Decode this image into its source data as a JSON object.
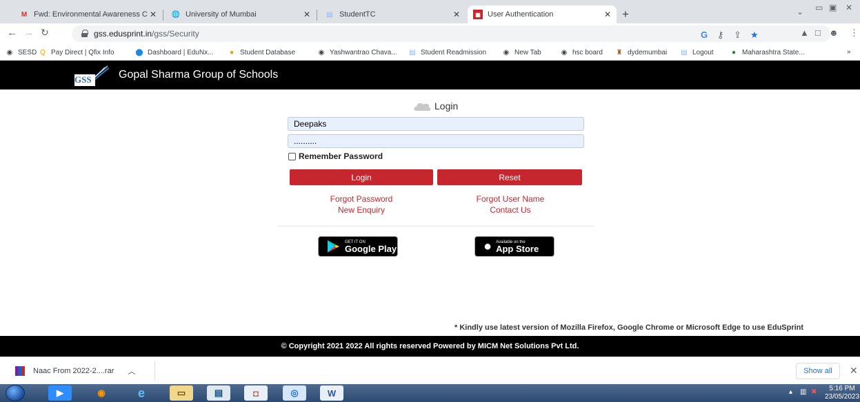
{
  "browser": {
    "tabs": [
      {
        "title": "Fwd: Environmental Awareness C",
        "icon": "gmail-icon"
      },
      {
        "title": "University of Mumbai",
        "icon": "globe-icon"
      },
      {
        "title": "StudentTC",
        "icon": "document-icon"
      },
      {
        "title": "User Authentication",
        "icon": "site-icon",
        "active": true
      }
    ],
    "address": {
      "host": "gss.edusprint.in",
      "path": "/gss/Security"
    },
    "bookmarks": [
      {
        "label": "SESD",
        "icon": "globe-icon"
      },
      {
        "label": "Pay Direct | Qfix Info",
        "icon": "qfix-icon"
      },
      {
        "label": "Dashboard | EduNx...",
        "icon": "edunx-icon"
      },
      {
        "label": "Student Database",
        "icon": "orange-dot-icon"
      },
      {
        "label": "Yashwantrao Chava...",
        "icon": "globe-icon"
      },
      {
        "label": "Student Readmission",
        "icon": "document-icon"
      },
      {
        "label": "New Tab",
        "icon": "globe-icon"
      },
      {
        "label": "hsc board",
        "icon": "globe-icon"
      },
      {
        "label": "dydemumbai",
        "icon": "emblem-icon"
      },
      {
        "label": "Logout",
        "icon": "document-icon"
      },
      {
        "label": "Maharashtra State...",
        "icon": "green-dot-icon"
      }
    ]
  },
  "site": {
    "logo_text": "GSS",
    "name": "Gopal Sharma Group of Schools"
  },
  "login": {
    "heading": "Login",
    "username": "Deepaks",
    "password": "..........",
    "remember_label": "Remember Password",
    "login_button": "Login",
    "reset_button": "Reset",
    "forgot_password": "Forgot Password",
    "forgot_username": "Forgot User Name",
    "new_enquiry": "New Enquiry",
    "contact_us": "Contact Us",
    "google_play_small": "GET IT ON",
    "google_play_big": "Google Play",
    "app_store_small": "Available on the",
    "app_store_big": "App Store"
  },
  "notice": "* Kindly use latest version of Mozilla Firefox, Google Chrome or Microsoft Edge to use EduSprint",
  "footer": "© Copyright 2021 2022 All rights reserved Powered by MICM Net Solutions Pvt Ltd.",
  "downloads": {
    "file": "Naac From 2022-2....rar",
    "show_all": "Show all"
  },
  "taskbar": {
    "time": "5:16 PM",
    "date": "23/05/2023"
  },
  "colors": {
    "accent_red": "#c6262e",
    "header_bg": "#000000",
    "input_bg": "#e8f0fe"
  }
}
